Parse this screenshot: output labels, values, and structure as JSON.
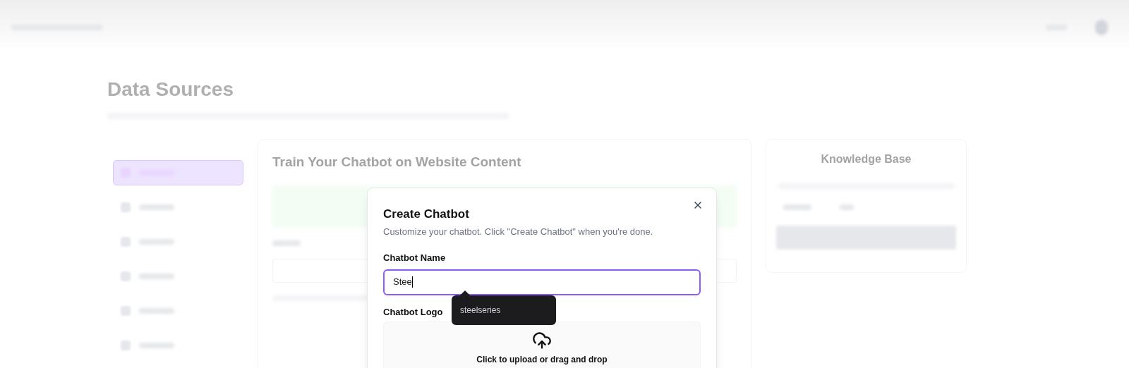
{
  "page": {
    "title": "Data Sources",
    "section_title": "Train Your Chatbot on Website Content",
    "side_card_title": "Knowledge Base"
  },
  "sidebar": {
    "items": [
      {
        "selected": true
      },
      {
        "selected": false
      },
      {
        "selected": false
      },
      {
        "selected": false
      },
      {
        "selected": false
      },
      {
        "selected": false
      }
    ]
  },
  "dialog": {
    "title": "Create Chatbot",
    "subtitle": "Customize your chatbot. Click \"Create Chatbot\" when you're done.",
    "fields": [
      {
        "kind": "text",
        "label": "Chatbot Name",
        "value": "Stee",
        "focused": true
      },
      {
        "kind": "upload",
        "label": "Chatbot Logo",
        "hint": "Click to upload or drag and drop"
      }
    ],
    "autocomplete": {
      "suggestion": "steelseries"
    }
  }
}
